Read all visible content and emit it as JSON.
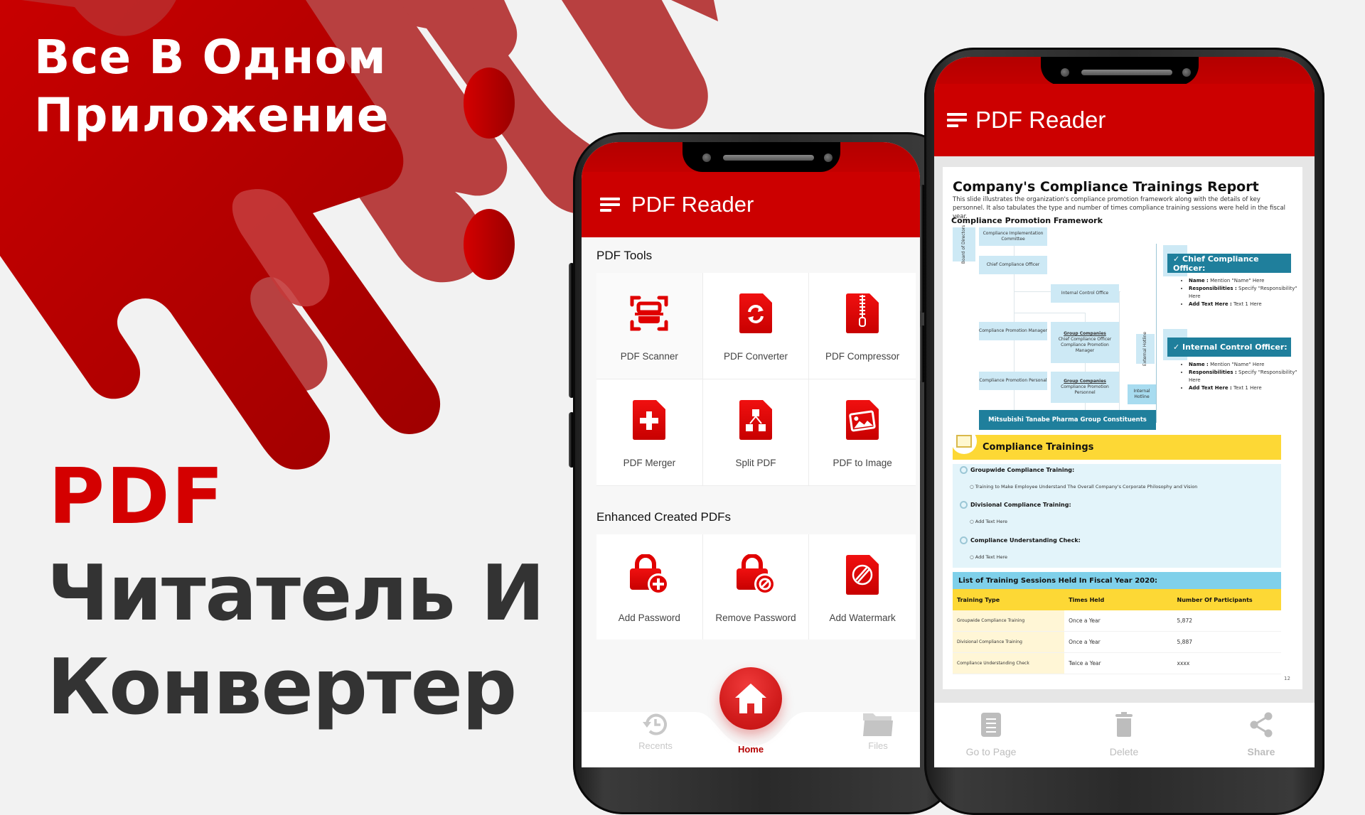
{
  "promo": {
    "headline_lines": [
      "Все В Одном",
      "Приложение"
    ],
    "accent_word": "PDF",
    "subhead_lines": [
      "Читатель И",
      "Конвертер"
    ],
    "colors": {
      "brand_red": "#cc0000",
      "dark_text": "#333333",
      "background": "#f2f2f2"
    }
  },
  "home_screen": {
    "app_title": "PDF Reader",
    "menu_icon": "hamburger-menu-icon",
    "tools_section": {
      "title": "PDF Tools",
      "items": [
        {
          "label": "PDF Scanner",
          "icon": "scanner-icon"
        },
        {
          "label": "PDF Converter",
          "icon": "convert-file-icon"
        },
        {
          "label": "PDF Compressor",
          "icon": "zip-file-icon"
        },
        {
          "label": "PDF Merger",
          "icon": "merge-file-icon"
        },
        {
          "label": "Split PDF",
          "icon": "split-file-icon"
        },
        {
          "label": "PDF to Image",
          "icon": "image-file-icon"
        }
      ]
    },
    "enhanced_section": {
      "title": "Enhanced Created PDFs",
      "items": [
        {
          "label": "Add Password",
          "icon": "lock-add-icon"
        },
        {
          "label": "Remove Password",
          "icon": "lock-remove-icon"
        },
        {
          "label": "Add Watermark",
          "icon": "watermark-file-icon"
        }
      ]
    },
    "bottom_nav": [
      {
        "label": "Recents",
        "icon": "history-icon",
        "active": false
      },
      {
        "label": "Home",
        "icon": "home-icon",
        "active": true
      },
      {
        "label": "Files",
        "icon": "folder-icon",
        "active": false
      }
    ]
  },
  "reader_screen": {
    "app_title": "PDF Reader",
    "document": {
      "title": "Company's Compliance Trainings Report",
      "subtitle": "This slide illustrates the organization's compliance promotion framework along with the details of key personnel. It also tabulates the type and number of times compliance training sessions were held in the fiscal year.",
      "framework_title": "Compliance Promotion Framework",
      "org_boxes": {
        "board": "Board of Directors",
        "committee": "Compliance Implementation Committee",
        "cco": "Chief Compliance Officer",
        "internal_control": "Internal Control Office",
        "promo_manager": "Compliance Promotion Manager",
        "group_cco_title": "Group Companies",
        "group_cco_body": "Chief Compliance Officer Compliance Promotion Manager",
        "external_hotline": "External Hotline",
        "promo_personal": "Compliance Promotion Personal",
        "group_personnel_title": "Group Companies",
        "group_personnel_body": "Compliance Promotion Personnel",
        "internal_hotline": "Internal Hotline",
        "constituents": "Mitsubishi Tanabe Pharma Group Constituents"
      },
      "officers": [
        {
          "title": "✓ Chief Compliance Officer:",
          "bullets": [
            {
              "key": "Name :",
              "value": " Mention \"Name\" Here"
            },
            {
              "key": "Responsibilities :",
              "value": " Specify \"Responsibility\" Here"
            },
            {
              "key": "Add Text Here :",
              "value": " Text 1 Here"
            }
          ]
        },
        {
          "title": "✓ Internal Control Officer:",
          "bullets": [
            {
              "key": "Name :",
              "value": " Mention \"Name\" Here"
            },
            {
              "key": "Responsibilities :",
              "value": " Specify \"Responsibility\" Here"
            },
            {
              "key": "Add Text Here :",
              "value": " Text 1 Here"
            }
          ]
        }
      ],
      "trainings_title": "Compliance Trainings",
      "trainings": [
        {
          "title": "Groupwide Compliance Training:",
          "detail": "Training to Make Employee Understand The Overall Company's Corporate Philosophy and Vision"
        },
        {
          "title": "Divisional Compliance Training:",
          "detail": "Add Text Here"
        },
        {
          "title": "Compliance Understanding Check:",
          "detail": "Add Text Here"
        }
      ],
      "sessions_title": "List of Training Sessions Held In Fiscal Year 2020:",
      "sessions_table": {
        "headers": [
          "Training Type",
          "Times Held",
          "Number Of Participants"
        ],
        "rows": [
          [
            "Groupwide Compliance Training",
            "Once a Year",
            "5,872"
          ],
          [
            "Divisional Compliance Training",
            "Once a Year",
            "5,887"
          ],
          [
            "Compliance Understanding Check",
            "Twice a Year",
            "xxxx"
          ]
        ]
      },
      "page_number": "12"
    },
    "actions": [
      {
        "label": "Go to Page",
        "icon": "go-to-page-icon"
      },
      {
        "label": "Delete",
        "icon": "trash-icon"
      },
      {
        "label": "Share",
        "icon": "share-icon"
      }
    ]
  }
}
